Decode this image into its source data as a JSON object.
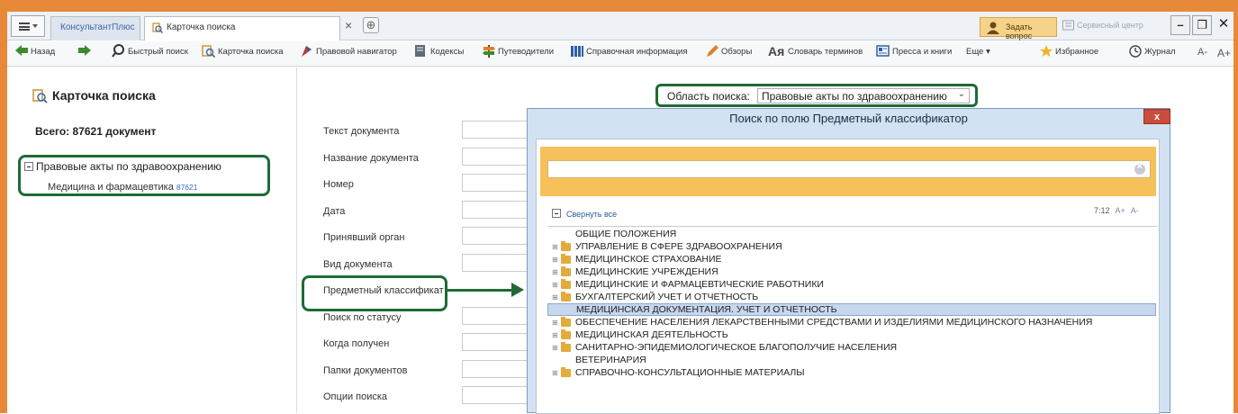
{
  "titlebar": {
    "brand_tab": "КонсультантПлюс",
    "active_tab": "Карточка поиска",
    "ask_button": "Задать вопрос",
    "service_center": "Сервисный центр"
  },
  "toolbar": {
    "back": "Назад",
    "quick_search": "Быстрый поиск",
    "search_card": "Карточка поиска",
    "legal_navigator": "Правовой навигатор",
    "codes": "Кодексы",
    "guides": "Путеводители",
    "reference": "Справочная информация",
    "reviews": "Обзоры",
    "glossary_icon_text": "Ая",
    "glossary": "Словарь терминов",
    "press": "Пресса и книги",
    "more": "Еще ▾",
    "favorites": "Избранное",
    "journal": "Журнал",
    "font_minus": "A-",
    "font_plus": "A+"
  },
  "left": {
    "title": "Карточка поиска",
    "total": "Всего: 87621 документ",
    "tree_node": "Правовые акты по здравоохранению",
    "tree_child": "Медицина и фармацевтика",
    "tree_child_count": "87621"
  },
  "search_area": {
    "label": "Область поиска:",
    "value": "Правовые акты по здравоохранению"
  },
  "form_fields": [
    "Текст документа",
    "Название документа",
    "Номер",
    "Дата",
    "Принявший орган",
    "Вид документа",
    "Предметный классификатор",
    "Поиск по статусу",
    "Когда получен",
    "Папки документов",
    "Опции поиска"
  ],
  "dialog": {
    "title": "Поиск по полю Предметный классификатор",
    "close": "x",
    "search_placeholder": "",
    "collapse_all": "Свернуть все",
    "font_size": "7:12",
    "font_plus": "A+",
    "font_minus": "A-",
    "items": [
      {
        "label": "ОБЩИЕ ПОЛОЖЕНИЯ",
        "expandable": false,
        "selected": false
      },
      {
        "label": "УПРАВЛЕНИЕ В СФЕРЕ ЗДРАВООХРАНЕНИЯ",
        "expandable": true,
        "selected": false
      },
      {
        "label": "МЕДИЦИНСКОЕ СТРАХОВАНИЕ",
        "expandable": true,
        "selected": false
      },
      {
        "label": "МЕДИЦИНСКИЕ УЧРЕЖДЕНИЯ",
        "expandable": true,
        "selected": false
      },
      {
        "label": "МЕДИЦИНСКИЕ И ФАРМАЦЕВТИЧЕСКИЕ РАБОТНИКИ",
        "expandable": true,
        "selected": false
      },
      {
        "label": "БУХГАЛТЕРСКИЙ УЧЕТ И ОТЧЕТНОСТЬ",
        "expandable": true,
        "selected": false
      },
      {
        "label": "МЕДИЦИНСКАЯ ДОКУМЕНТАЦИЯ. УЧЕТ И ОТЧЕТНОСТЬ",
        "expandable": false,
        "selected": true
      },
      {
        "label": "ОБЕСПЕЧЕНИЕ НАСЕЛЕНИЯ ЛЕКАРСТВЕННЫМИ СРЕДСТВАМИ И ИЗДЕЛИЯМИ МЕДИЦИНСКОГО НАЗНАЧЕНИЯ",
        "expandable": true,
        "selected": false
      },
      {
        "label": "МЕДИЦИНСКАЯ ДЕЯТЕЛЬНОСТЬ",
        "expandable": true,
        "selected": false
      },
      {
        "label": "САНИТАРНО-ЭПИДЕМИОЛОГИЧЕСКОЕ БЛАГОПОЛУЧИЕ НАСЕЛЕНИЯ",
        "expandable": true,
        "selected": false
      },
      {
        "label": "ВЕТЕРИНАРИЯ",
        "expandable": false,
        "selected": false
      },
      {
        "label": "СПРАВОЧНО-КОНСУЛЬТАЦИОННЫЕ МАТЕРИАЛЫ",
        "expandable": true,
        "selected": false
      }
    ]
  },
  "colors": {
    "frame": "#e8893a",
    "highlight_green": "#1f6b36",
    "search_band": "#f6c15a",
    "dialog_bg": "#d2e2f3",
    "selection": "#c7d7ee"
  }
}
